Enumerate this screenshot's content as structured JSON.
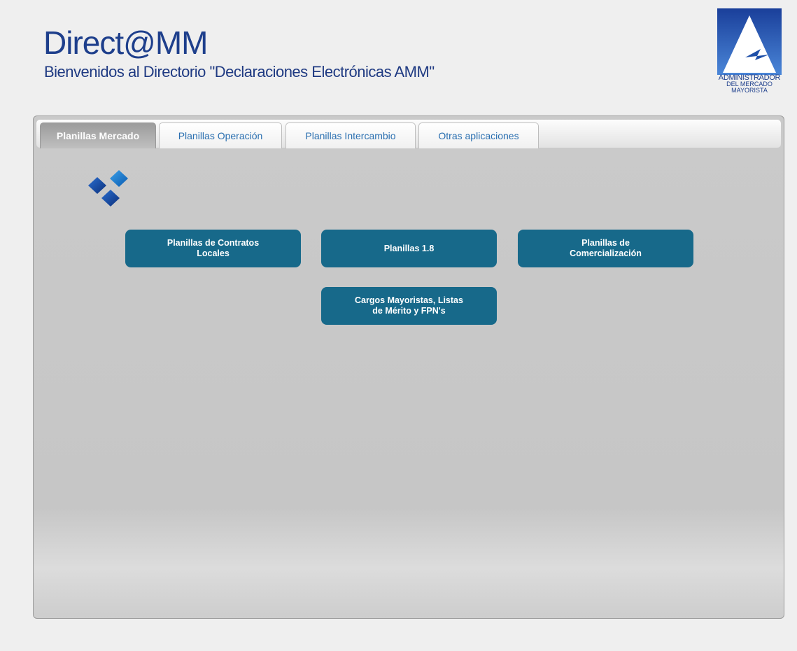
{
  "header": {
    "title": "Direct@MM",
    "subtitle": "Bienvenidos al Directorio \"Declaraciones Electrónicas AMM\""
  },
  "logo": {
    "line1": "ADMINISTRADOR",
    "line2": "DEL MERCADO",
    "line3": "MAYORISTA"
  },
  "tabs": [
    {
      "label": "Planillas Mercado",
      "active": true
    },
    {
      "label": "Planillas Operación",
      "active": false
    },
    {
      "label": "Planillas Intercambio",
      "active": false
    },
    {
      "label": "Otras aplicaciones",
      "active": false
    }
  ],
  "buttons": [
    {
      "label": "Planillas de Contratos Locales"
    },
    {
      "label": "Planillas 1.8"
    },
    {
      "label": "Planillas de Comercialización"
    },
    {
      "label": "Cargos Mayoristas, Listas de Mérito y FPN's"
    }
  ],
  "colors": {
    "accent": "#17698a",
    "brand": "#1e3f8c",
    "tab_text": "#2a6fb0"
  }
}
